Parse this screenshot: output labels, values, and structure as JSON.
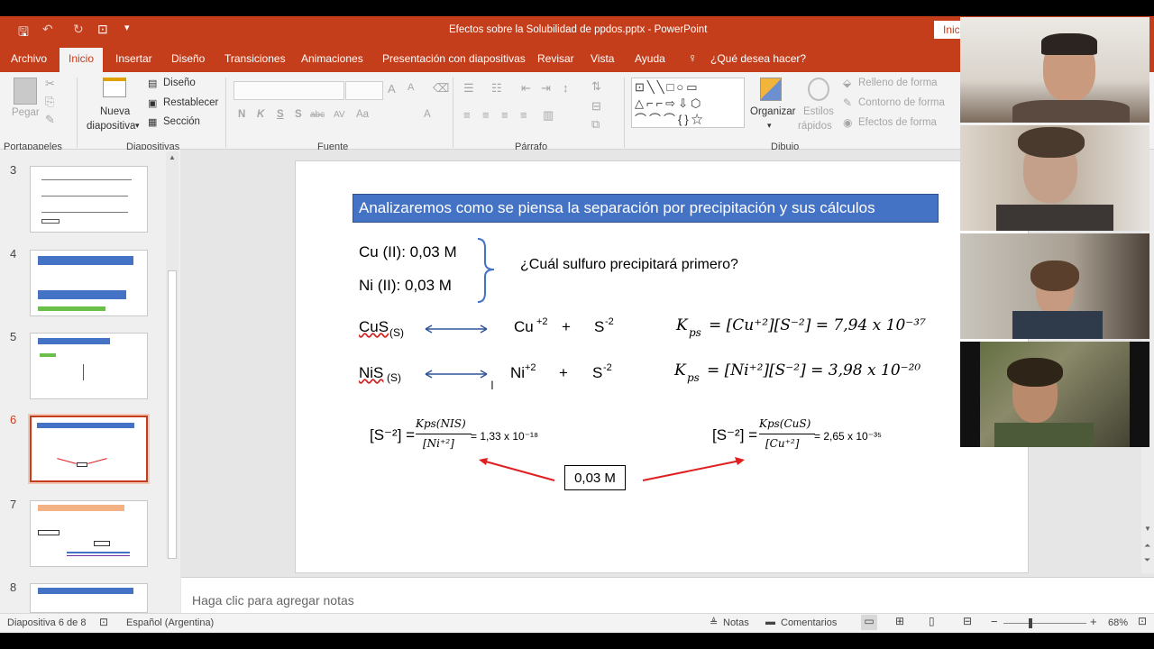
{
  "window": {
    "title": "Efectos sobre la Solubilidad de ppdos.pptx  -  PowerPoint",
    "signin": "Inic"
  },
  "tabs": [
    "Archivo",
    "Inicio",
    "Insertar",
    "Diseño",
    "Transiciones",
    "Animaciones",
    "Presentación con diapositivas",
    "Revisar",
    "Vista",
    "Ayuda"
  ],
  "tell_me": "¿Qué desea hacer?",
  "ribbon": {
    "paste": "Pegar",
    "new_slide_1": "Nueva",
    "new_slide_2": "diapositiva",
    "layout": "Diseño",
    "reset": "Restablecer",
    "section": "Sección",
    "organize": "Organizar",
    "quick_styles_1": "Estilos",
    "quick_styles_2": "rápidos",
    "shape_fill": "Relleno de forma",
    "shape_outline": "Contorno de forma",
    "shape_effects": "Efectos de forma",
    "font_buttons": [
      "N",
      "K",
      "S",
      "S",
      "abc",
      "AV",
      "Aa",
      "A"
    ],
    "groups": [
      "Portapapeles",
      "Diapositivas",
      "Fuente",
      "Párrafo",
      "Dibujo"
    ]
  },
  "thumbnails": {
    "numbers": [
      "3",
      "4",
      "5",
      "6",
      "7",
      "8"
    ],
    "selected": "6"
  },
  "slide": {
    "title": "Analizaremos como se piensa la separación por precipitación y sus cálculos",
    "cu": "Cu (II): 0,03 M",
    "ni": "Ni (II): 0,03 M",
    "question": "¿Cuál sulfuro precipitará primero?",
    "cus": "CuS",
    "nis": "NiS",
    "solid": "(S)",
    "cu_ion": "Cu",
    "ni_ion": "Ni",
    "charge_plus": "+2",
    "charge_minus": "-2",
    "plus": "+",
    "s": "S",
    "kps": "K",
    "ps": "ps",
    "eq1_rhs": "= [Cu⁺²][S⁻²] = 7,94 x 10⁻³⁷",
    "eq2_rhs": "= [Ni⁺²][S⁻²] = 3,98 x 10⁻²⁰",
    "s_conc": "[S⁻²] =",
    "frac1_num": "Kps(NIS)",
    "frac1_den": "[Ni⁺²]",
    "frac1_res": "= 1,33 x 10⁻¹⁸",
    "frac2_num": "Kps(CuS)",
    "frac2_den": "[Cu⁺²]",
    "frac2_res": "= 2,65 x 10⁻³⁵",
    "box": "0,03 M"
  },
  "notes_placeholder": "Haga clic para agregar notas",
  "status": {
    "slide": "Diapositiva 6 de 8",
    "language": "Español (Argentina)",
    "notes": "Notas",
    "comments": "Comentarios",
    "zoom_minus": "−",
    "zoom_plus": "+",
    "zoom": "68%"
  },
  "colors": {
    "accent": "#c43e1c",
    "slide_title_bg": "#4472c4",
    "arrow": "#e02020"
  }
}
